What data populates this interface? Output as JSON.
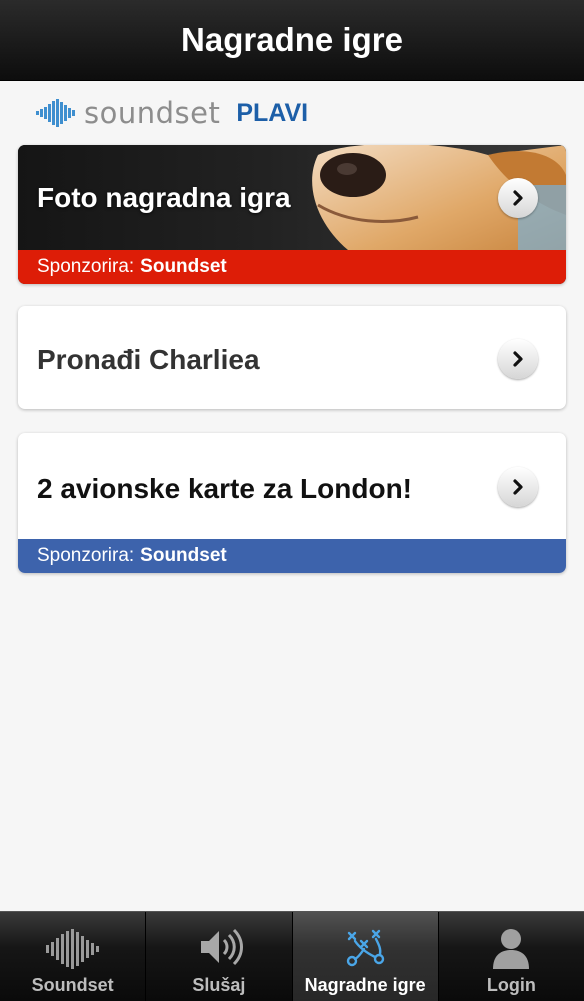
{
  "header": {
    "title": "Nagradne igre"
  },
  "brand": {
    "name": "soundset",
    "tag": "PLAVI",
    "logo_icon": "soundwave-icon"
  },
  "cards": [
    {
      "title": "Foto nagradna igra",
      "sponsor_label": "Sponzorira:",
      "sponsor_name": "Soundset",
      "sponsor_color": "#dd1d07",
      "image": "dog-photo"
    },
    {
      "title": "Pronađi Charliea"
    },
    {
      "title": "2 avionske karte za London!",
      "sponsor_label": "Sponzorira:",
      "sponsor_name": "Soundset",
      "sponsor_color": "#3d63ac"
    }
  ],
  "tabs": [
    {
      "label": "Soundset",
      "icon": "soundwave-icon",
      "active": false
    },
    {
      "label": "Slušaj",
      "icon": "speaker-icon",
      "active": false
    },
    {
      "label": "Nagradne igre",
      "icon": "strategy-board-icon",
      "active": true
    },
    {
      "label": "Login",
      "icon": "user-icon",
      "active": false
    }
  ]
}
